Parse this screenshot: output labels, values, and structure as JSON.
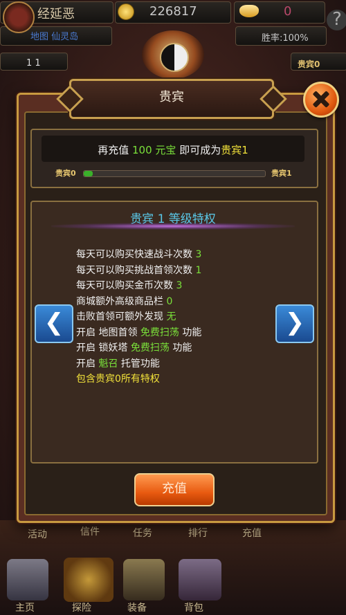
{
  "hud": {
    "player_name": "经延恶",
    "gold": "226817",
    "yuanbao": "0",
    "map": "地图 仙灵岛",
    "win_rate": "胜率:100%",
    "small_counter": "1 1",
    "vip_badge": "贵宾0",
    "help": "?"
  },
  "dialog": {
    "title": "贵宾",
    "close_icon": "close-icon"
  },
  "progress": {
    "text_prefix": "再充值",
    "amount": "100 元宝",
    "text_middle": "即可成为",
    "target_vip": "贵宾1",
    "from_label": "贵宾0",
    "to_label": "贵宾1",
    "fraction": 0.05
  },
  "privileges": {
    "title": "贵宾 1 等级特权",
    "items": [
      {
        "text": "每天可以购买快速战斗次数",
        "value": "3"
      },
      {
        "text": "每天可以购买挑战首领次数",
        "value": "1"
      },
      {
        "text": "每天可以购买金币次数",
        "value": "3"
      },
      {
        "text": "商城额外高级商品栏",
        "value": "0"
      },
      {
        "text": "击败首领可额外发现",
        "value": "无"
      }
    ],
    "feature1": {
      "prefix": "开启",
      "name": "地图首领",
      "highlight": "免费扫荡",
      "suffix": "功能"
    },
    "feature2": {
      "prefix": "开启",
      "name": "锁妖塔",
      "highlight": "免费扫荡",
      "suffix": "功能"
    },
    "feature3": {
      "prefix": "开启",
      "highlight": "魁召",
      "suffix": "托管功能"
    },
    "inherit": "包含贵宾0所有特权",
    "prev_icon": "chevron-left-icon",
    "next_icon": "chevron-right-icon"
  },
  "recharge_button": "充值",
  "bottom_nav": {
    "top_row": [
      "活动",
      "信件",
      "任务",
      "排行",
      "充值"
    ],
    "bottom_row": [
      "主页",
      "探险",
      "装备",
      "背包"
    ]
  }
}
